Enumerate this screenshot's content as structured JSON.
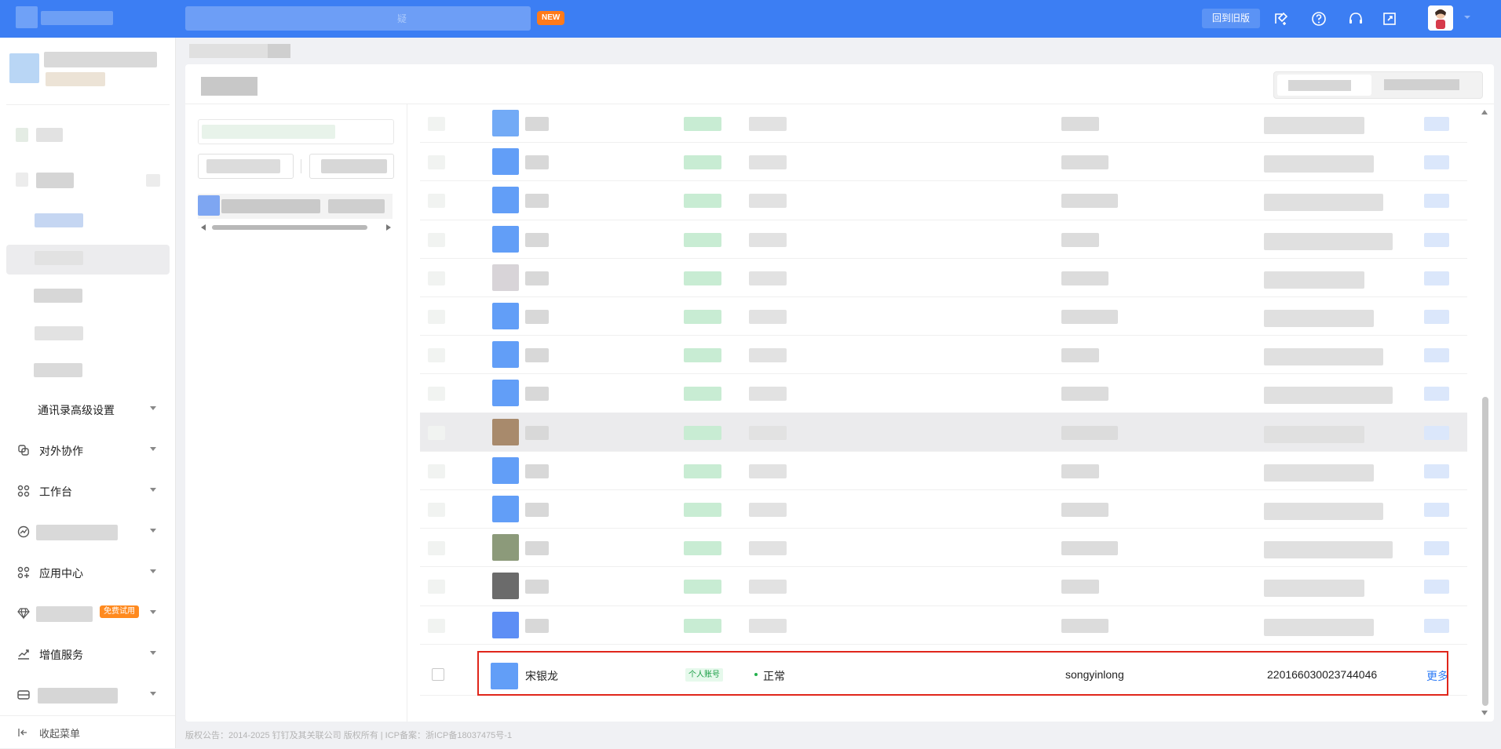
{
  "topbar": {
    "search_hint": "疑",
    "new_badge": "NEW",
    "old_version_button": "回到旧版",
    "icons": [
      "upload-icon",
      "help-icon",
      "headset-icon",
      "fullscreen-icon"
    ]
  },
  "sidebar": {
    "items": [
      {
        "label": "通讯录高级设置",
        "icon": ""
      },
      {
        "label": "对外协作",
        "icon": "collab-icon"
      },
      {
        "label": "工作台",
        "icon": "grid-icon"
      },
      {
        "label": "",
        "icon": "chart-icon"
      },
      {
        "label": "应用中心",
        "icon": "apps-icon"
      },
      {
        "label": "",
        "icon": "diamond-icon",
        "badge": "免费试用"
      },
      {
        "label": "增值服务",
        "icon": "trend-icon"
      },
      {
        "label": "",
        "icon": "card-icon"
      }
    ],
    "collapse_label": "收起菜单"
  },
  "table": {
    "visible_row": {
      "name": "宋银龙",
      "type_tag": "个人账号",
      "status": "正常",
      "account": "songyinlong",
      "phone": "220166030023744046",
      "action": "更多"
    }
  },
  "footer": "版权公告：2014-2025 钉钉及其关联公司 版权所有 | ICP备案：浙ICP备18037475号-1",
  "colors": {
    "primary": "#3c7ef3",
    "status_green": "#22b14c",
    "highlight": "#e0261b"
  }
}
